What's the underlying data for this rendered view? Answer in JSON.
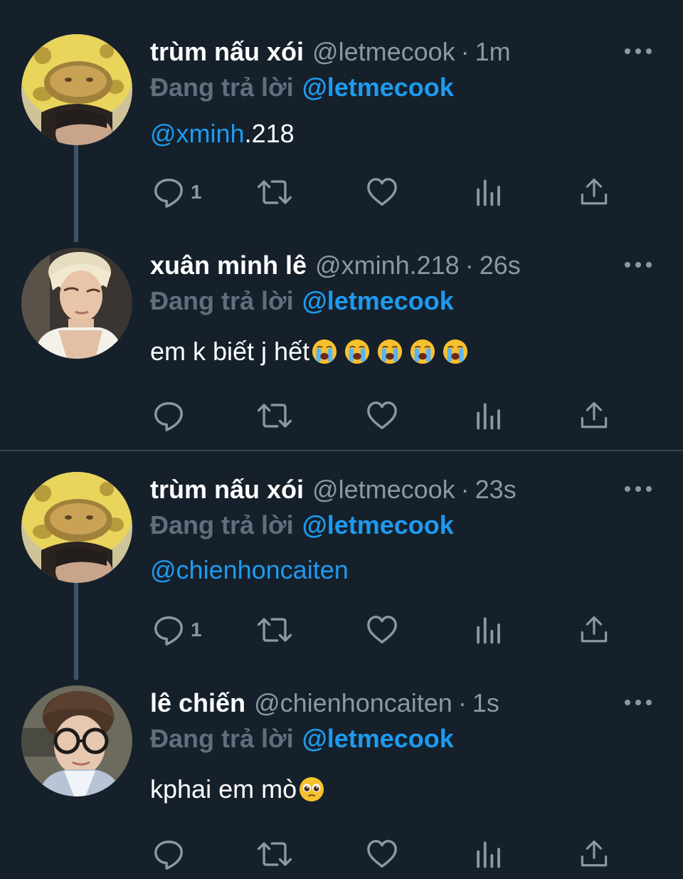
{
  "reply_prefix": "Đang trả lời",
  "tweets": [
    {
      "name": "trùm nấu xói",
      "handle": "@letmecook",
      "time": "1m",
      "reply_to": "@letmecook",
      "body_mention": "@xminh",
      "body_text": ".218",
      "reply_count": "1",
      "avatar": "giraffe-hat-avatar"
    },
    {
      "name": "xuân minh lê",
      "handle": "@xminh.218",
      "time": "26s",
      "reply_to": "@letmecook",
      "body_mention": "",
      "body_text": "em k biết j hết",
      "emojis": [
        "loudly-crying-face",
        "loudly-crying-face",
        "loudly-crying-face",
        "loudly-crying-face",
        "loudly-crying-face"
      ],
      "reply_count": "",
      "avatar": "blonde-hair-avatar"
    },
    {
      "name": "trùm nấu xói",
      "handle": "@letmecook",
      "time": "23s",
      "reply_to": "@letmecook",
      "body_mention": "@chienhoncaiten",
      "body_text": "",
      "reply_count": "1",
      "avatar": "giraffe-hat-avatar"
    },
    {
      "name": "lê chiến",
      "handle": "@chienhoncaiten",
      "time": "1s",
      "reply_to": "@letmecook",
      "body_mention": "",
      "body_text": "kphai em mò",
      "emojis": [
        "pleading-face"
      ],
      "reply_count": "",
      "avatar": "glasses-avatar"
    }
  ],
  "icons": {
    "reply": "speech-bubble-icon",
    "retweet": "retweet-arrows-icon",
    "like": "heart-icon",
    "views": "bar-chart-icon",
    "share": "upload-arrow-icon",
    "more": "ellipsis-icon"
  },
  "colors": {
    "background": "#15202b",
    "accent": "#1d9bf0",
    "muted": "#8b98a5",
    "thread_line": "#3d5466"
  }
}
